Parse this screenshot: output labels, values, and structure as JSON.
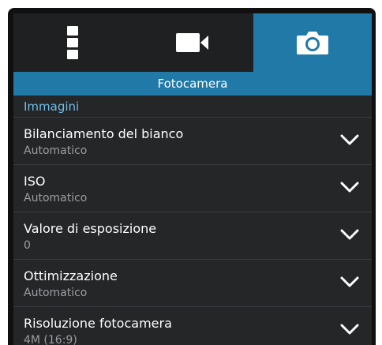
{
  "tabs": [
    {
      "icon": "more-vertical-icon",
      "selected": false
    },
    {
      "icon": "video-camera-icon",
      "selected": false
    },
    {
      "icon": "camera-icon",
      "selected": true
    }
  ],
  "section_title": "Fotocamera",
  "group_label": "Immagini",
  "settings": [
    {
      "title": "Bilanciamento del bianco",
      "value": "Automatico",
      "icon": "chevron-down-icon"
    },
    {
      "title": "ISO",
      "value": "Automatico",
      "icon": "chevron-down-icon"
    },
    {
      "title": "Valore di esposizione",
      "value": "0",
      "icon": "chevron-down-icon"
    },
    {
      "title": "Ottimizzazione",
      "value": "Automatico",
      "icon": "chevron-down-icon"
    },
    {
      "title": "Risoluzione fotocamera",
      "value": "4M (16:9)",
      "icon": "chevron-down-icon"
    }
  ],
  "colors": {
    "accent": "#2179a8",
    "group_label": "#6fbde8",
    "background": "#252628",
    "secondary_text": "#9c9da0"
  }
}
